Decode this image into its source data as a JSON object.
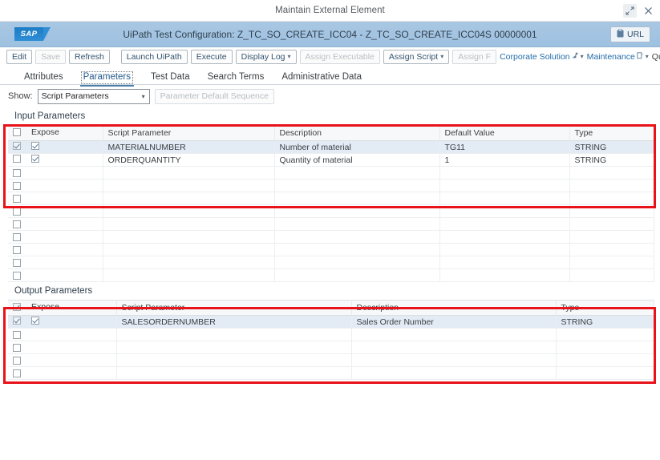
{
  "window": {
    "title": "Maintain External Element",
    "resize_icon": "resize-expand-icon",
    "close_icon": "close-icon"
  },
  "shellbar": {
    "logo_text": "SAP",
    "title": "UiPath Test Configuration: Z_TC_SO_CREATE_ICC04 - Z_TC_SO_CREATE_ICC04S 00000001",
    "url_button": "URL",
    "url_icon": "clipboard-icon"
  },
  "toolbar": {
    "buttons": [
      {
        "label": "Edit",
        "disabled": false
      },
      {
        "label": "Save",
        "disabled": true
      },
      {
        "label": "Refresh",
        "disabled": false
      },
      {
        "label": "Launch UiPath",
        "disabled": false
      },
      {
        "label": "Execute",
        "disabled": false
      },
      {
        "label": "Display Log",
        "disabled": false,
        "caret": true
      },
      {
        "label": "Assign Executable",
        "disabled": true
      },
      {
        "label": "Assign Script",
        "disabled": false,
        "caret": true
      },
      {
        "label": "Assign F",
        "disabled": true
      }
    ],
    "status_links": [
      {
        "label": "Corporate Solution",
        "type": "link",
        "icon": "branch-icon",
        "caret": true
      },
      {
        "label": "Maintenance",
        "type": "link",
        "icon": "system-icon",
        "caret": true
      },
      {
        "label": "Quality Assurance System",
        "type": "plain",
        "icon": "",
        "caret": false
      }
    ]
  },
  "tabs": [
    {
      "label": "Attributes",
      "active": false
    },
    {
      "label": "Parameters",
      "active": true
    },
    {
      "label": "Test Data",
      "active": false
    },
    {
      "label": "Search Terms",
      "active": false
    },
    {
      "label": "Administrative Data",
      "active": false
    }
  ],
  "show_row": {
    "label": "Show:",
    "selected": "Script Parameters",
    "options": [
      "Script Parameters"
    ],
    "sequence_button": "Parameter Default Sequence"
  },
  "input_section": {
    "title": "Input Parameters",
    "columns": [
      "Expose",
      "Script Parameter",
      "Description",
      "Default Value",
      "Type"
    ],
    "header_select_all": false,
    "rows": [
      {
        "selected": true,
        "row_checked": true,
        "expose": true,
        "script_parameter": "MATERIALNUMBER",
        "description": "Number of material",
        "default_value": "TG11",
        "type": "STRING"
      },
      {
        "selected": false,
        "row_checked": false,
        "expose": true,
        "script_parameter": "ORDERQUANTITY",
        "description": "Quantity of material",
        "default_value": "1",
        "type": "STRING"
      }
    ],
    "empty_rows": 9
  },
  "output_section": {
    "title": "Output Parameters",
    "columns": [
      "Expose",
      "Script Parameter",
      "Description",
      "Type"
    ],
    "header_select_all": true,
    "rows": [
      {
        "selected": true,
        "row_checked": true,
        "expose": true,
        "script_parameter": "SALESORDERNUMBER",
        "description": "Sales Order Number",
        "type": "STRING"
      }
    ],
    "empty_rows": 4
  },
  "colors": {
    "annotation": "#e8131a",
    "shellbar": "#a3c3e0",
    "selected_row": "#e3ebf5",
    "link": "#246ca8"
  }
}
